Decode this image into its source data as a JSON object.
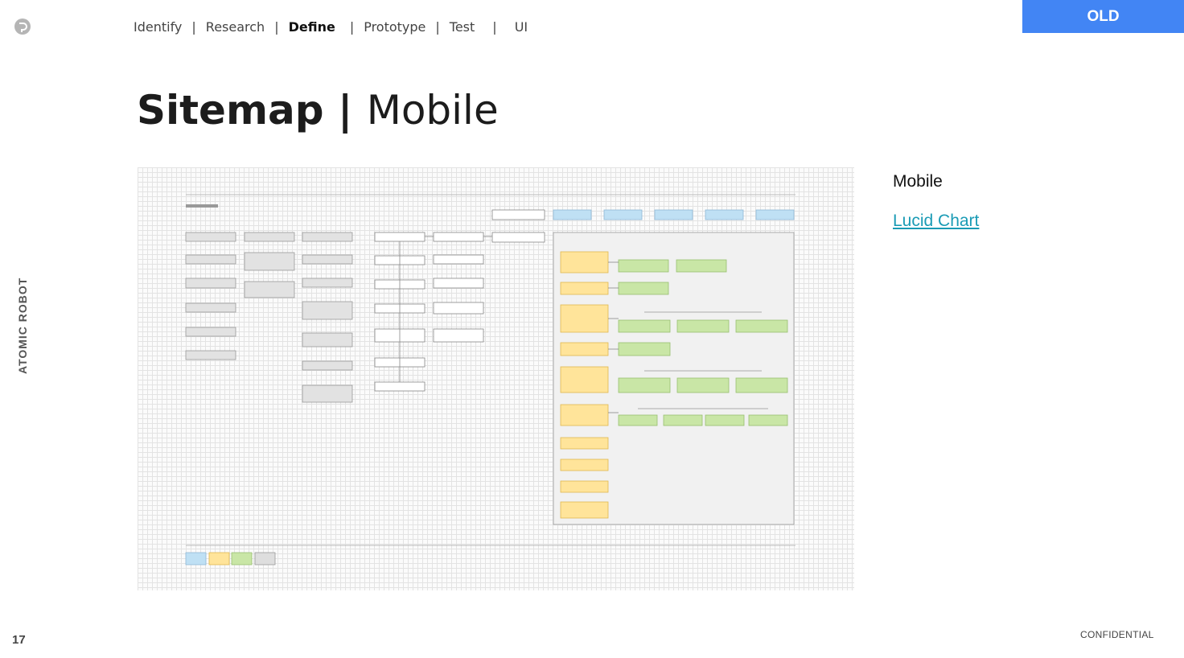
{
  "header": {
    "nav": [
      {
        "label": "Identify",
        "active": false
      },
      {
        "label": "Research",
        "active": false
      },
      {
        "label": "Define",
        "active": true
      },
      {
        "label": "Prototype",
        "active": false
      },
      {
        "label": "Test",
        "active": false
      },
      {
        "label": "UI",
        "active": false
      }
    ],
    "separator": "|",
    "badge": "OLD"
  },
  "title": {
    "bold": "Sitemap |",
    "light": "Mobile"
  },
  "side_label": "ATOMIC ROBOT",
  "page_number": "17",
  "footer": "CONFIDENTIAL",
  "aside": {
    "heading": "Mobile",
    "link": "Lucid Chart"
  },
  "colors": {
    "accent": "#4285f4",
    "link": "#1a9bb5",
    "blue_box": "#bfe0f4",
    "yellow_box": "#ffe49a",
    "green_box": "#c9e6a6",
    "gray_box": "#dedede"
  }
}
